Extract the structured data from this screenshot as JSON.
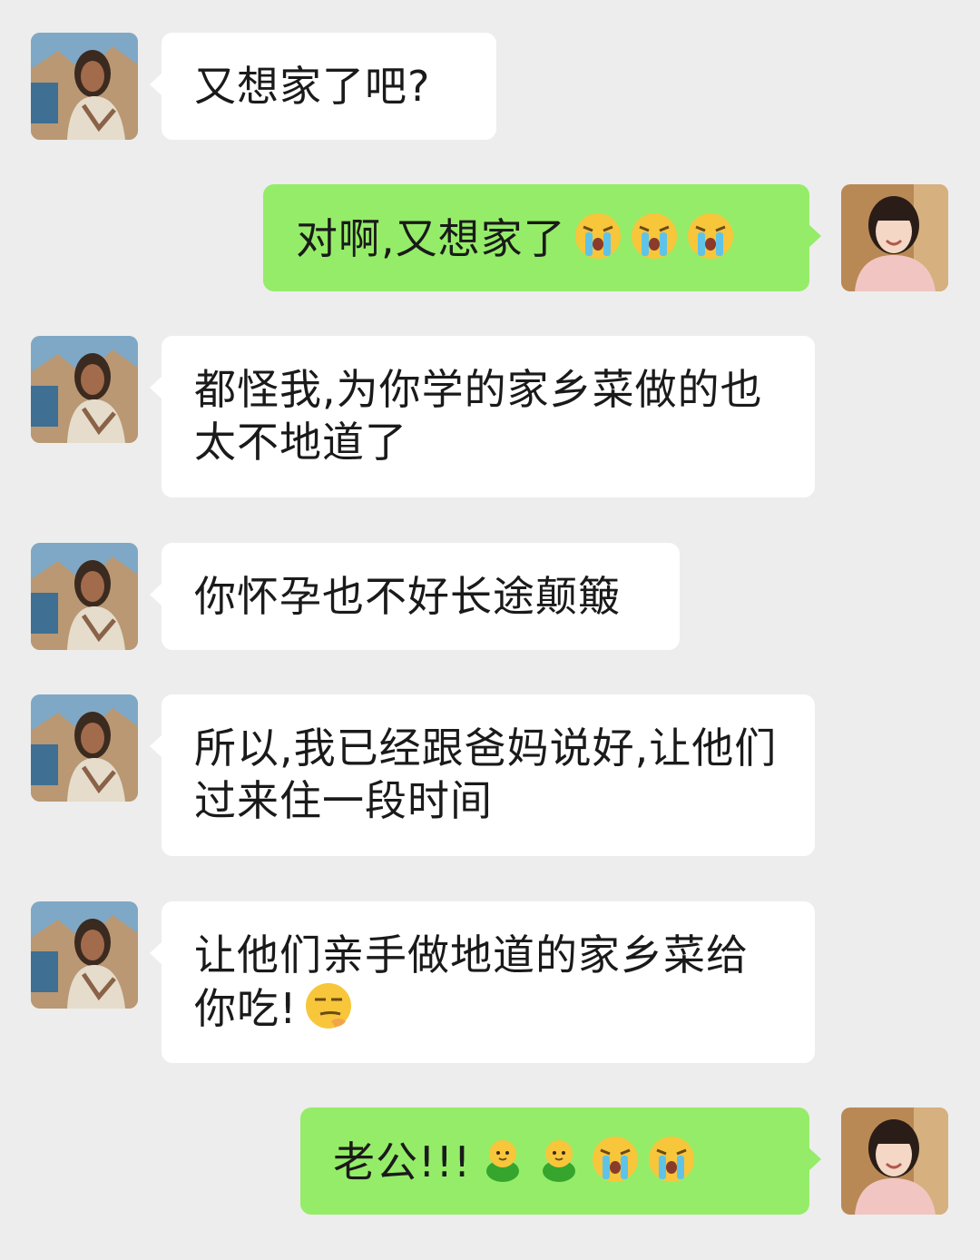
{
  "chat": {
    "messages": [
      {
        "side": "in",
        "text": "又想家了吧?"
      },
      {
        "side": "out",
        "text": "对啊,又想家了",
        "emoji": [
          "cry-emoji",
          "cry-emoji",
          "cry-emoji"
        ]
      },
      {
        "side": "in",
        "text": "都怪我,为你学的家乡菜做的也太不地道了"
      },
      {
        "side": "in",
        "text": "你怀孕也不好长途颠簸"
      },
      {
        "side": "in",
        "text": "所以,我已经跟爸妈说好,让他们过来住一段时间"
      },
      {
        "side": "in",
        "text": "让他们亲手做地道的家乡菜给你吃!",
        "emoji": [
          "smirk-emoji"
        ]
      },
      {
        "side": "out",
        "text": "老公!!!",
        "emoji": [
          "chick-emoji",
          "chick-emoji",
          "cry-emoji",
          "cry-emoji"
        ]
      }
    ]
  },
  "colors": {
    "background": "#ededed",
    "incoming_bubble": "#ffffff",
    "outgoing_bubble": "#95ec69"
  }
}
